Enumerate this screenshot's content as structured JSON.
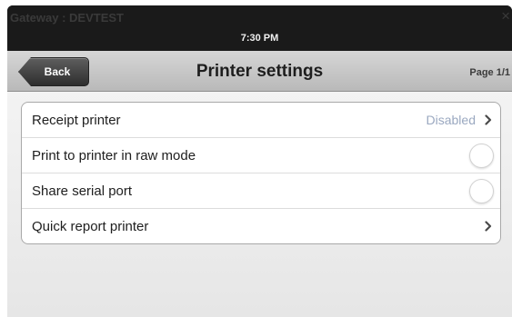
{
  "status": {
    "gateway": "Gateway : DEVTEST",
    "time": "7:30 PM",
    "close_glyph": "×"
  },
  "navbar": {
    "back_label": "Back",
    "title": "Printer settings",
    "page": "Page 1/1"
  },
  "settings": [
    {
      "label": "Receipt printer",
      "value": "Disabled",
      "control": "chevron-icon"
    },
    {
      "label": "Print to printer in raw mode",
      "control": "toggle"
    },
    {
      "label": "Share serial port",
      "control": "toggle"
    },
    {
      "label": "Quick report printer",
      "control": "chevron-icon"
    }
  ],
  "colors": {
    "value_text": "#9aa8c0",
    "navbar": "#c8c8c8",
    "status_bar": "#1a1a1a"
  }
}
